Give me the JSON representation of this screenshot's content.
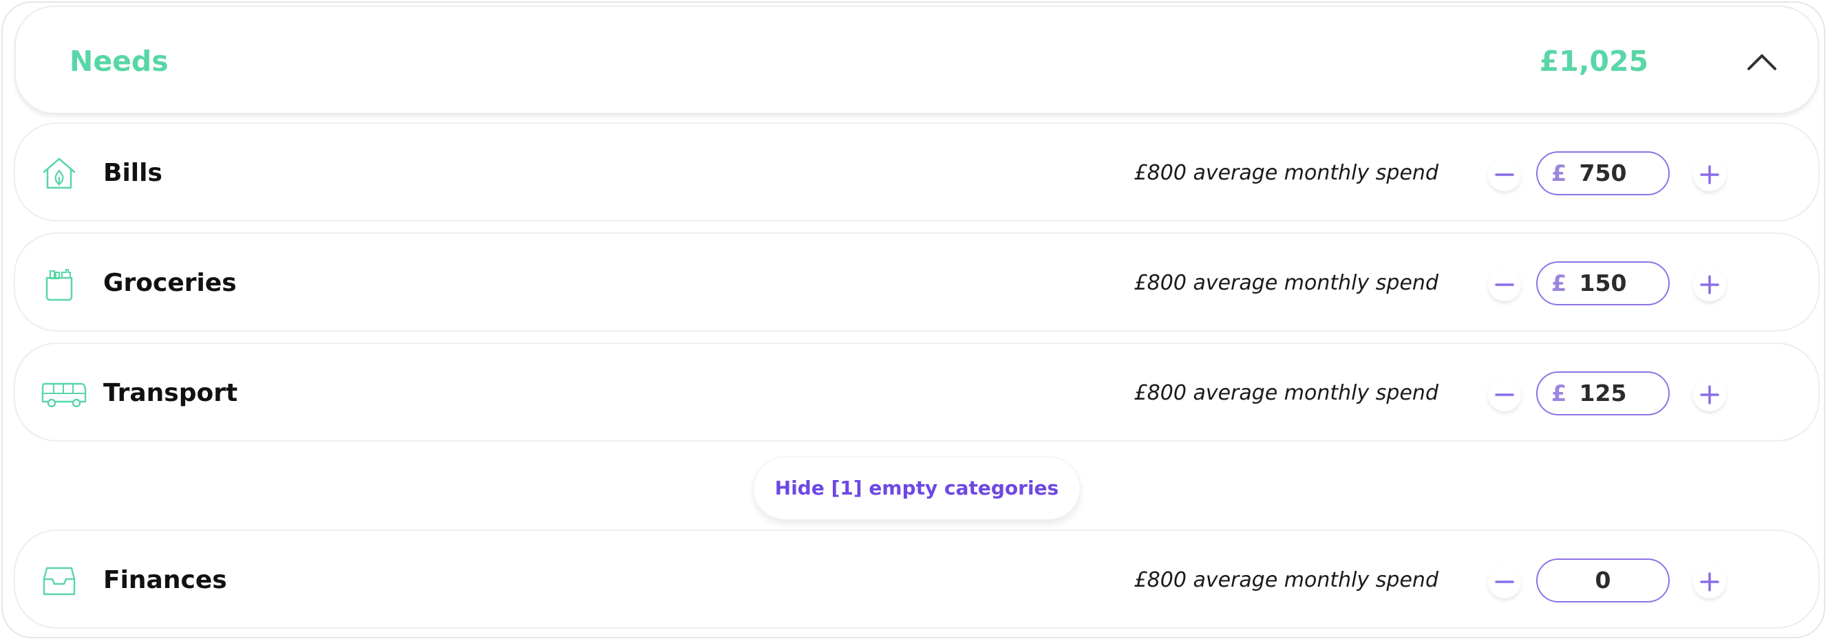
{
  "header": {
    "title": "Needs",
    "total": "£1,025",
    "collapse_icon": "chevron-up-icon"
  },
  "categories": [
    {
      "name": "Bills",
      "icon": "house-leaf-icon",
      "average": "£800 average monthly spend",
      "currency": "£",
      "amount": "750"
    },
    {
      "name": "Groceries",
      "icon": "grocery-bag-icon",
      "average": "£800 average monthly spend",
      "currency": "£",
      "amount": "150"
    },
    {
      "name": "Transport",
      "icon": "bus-icon",
      "average": "£800 average monthly spend",
      "currency": "£",
      "amount": "125"
    },
    {
      "name": "Finances",
      "icon": "inbox-tray-icon",
      "average": "£800 average monthly spend",
      "currency": "",
      "amount": "0"
    }
  ],
  "hide_empty_label": "Hide [1] empty categories",
  "colors": {
    "accent_green": "#58d6a7",
    "accent_purple": "#6d48e2",
    "input_border": "#8e72e8"
  }
}
